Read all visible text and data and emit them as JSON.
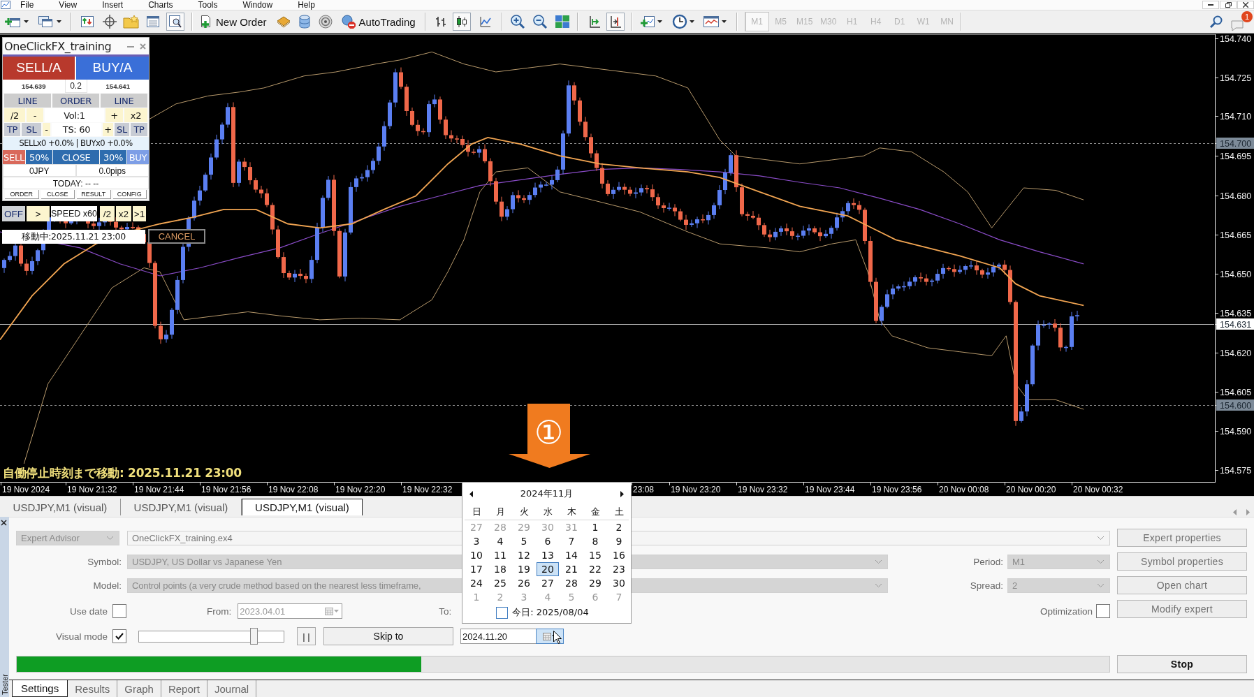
{
  "menu": [
    "File",
    "View",
    "Insert",
    "Charts",
    "Tools",
    "Window",
    "Help"
  ],
  "toolbar": {
    "tester_on": true,
    "new_order": "New Order",
    "autotrading": "AutoTrading",
    "chart_modes": [
      {
        "kind": "bar",
        "selected": false
      },
      {
        "kind": "candle",
        "selected": true
      },
      {
        "kind": "line",
        "selected": false
      }
    ],
    "auto_scroll_on": false,
    "chart_shift_on": true,
    "timeframes": [
      {
        "label": "M1",
        "selected": true,
        "disabled": true
      },
      {
        "label": "M5",
        "selected": false,
        "disabled": true
      },
      {
        "label": "M15",
        "selected": false,
        "disabled": true
      },
      {
        "label": "M30",
        "selected": false,
        "disabled": true
      },
      {
        "label": "H1",
        "selected": false,
        "disabled": true
      },
      {
        "label": "H4",
        "selected": false,
        "disabled": true
      },
      {
        "label": "D1",
        "selected": false,
        "disabled": true
      },
      {
        "label": "W1",
        "selected": false,
        "disabled": true
      },
      {
        "label": "MN",
        "selected": false,
        "disabled": true
      }
    ],
    "notifications": "1"
  },
  "chart": {
    "price_axis": [
      {
        "label": "154.740",
        "kind": "tick"
      },
      {
        "label": "154.725",
        "kind": "tick"
      },
      {
        "label": "154.710",
        "kind": "tick"
      },
      {
        "label": "154.700",
        "kind": "level"
      },
      {
        "label": "154.695",
        "kind": "tick"
      },
      {
        "label": "154.680",
        "kind": "tick"
      },
      {
        "label": "154.665",
        "kind": "tick"
      },
      {
        "label": "154.650",
        "kind": "tick"
      },
      {
        "label": "154.635",
        "kind": "tick"
      },
      {
        "label": "154.631",
        "kind": "bid"
      },
      {
        "label": "154.620",
        "kind": "tick"
      },
      {
        "label": "154.605",
        "kind": "tick"
      },
      {
        "label": "154.600",
        "kind": "level"
      },
      {
        "label": "154.590",
        "kind": "tick"
      },
      {
        "label": "154.575",
        "kind": "tick"
      }
    ],
    "time_axis": [
      "19 Nov 2024",
      "19 Nov 21:32",
      "19 Nov 21:44",
      "19 Nov 21:56",
      "19 Nov 22:08",
      "19 Nov 22:20",
      "19 Nov 22:32",
      "23:08",
      "19 Nov 23:20",
      "19 Nov 23:32",
      "19 Nov 23:44",
      "19 Nov 23:56",
      "20 Nov 00:08",
      "20 Nov 00:20",
      "20 Nov 00:32"
    ],
    "status": "自働停止時刻まで移動: 2025.11.21 23:00",
    "marker": "①"
  },
  "trade_panel": {
    "title": "OneClickFX_training",
    "sell_button": "SELL/A",
    "buy_button": "BUY/A",
    "lot": "0.2",
    "sell_price": "154.639",
    "buy_price": "154.641",
    "line_row": [
      "LINE",
      "ORDER",
      "LINE"
    ],
    "volume_row": [
      {
        "label": "/2",
        "kind": "step"
      },
      {
        "label": "-",
        "kind": "step"
      },
      {
        "label": "Vol:1",
        "kind": "value"
      },
      {
        "label": "+",
        "kind": "step"
      },
      {
        "label": "x2",
        "kind": "step"
      }
    ],
    "stop_row": [
      {
        "label": "TP",
        "kind": "tag"
      },
      {
        "label": "SL",
        "kind": "tag"
      },
      {
        "label": "-",
        "kind": "step"
      },
      {
        "label": "TS: 60",
        "kind": "value"
      },
      {
        "label": "+",
        "kind": "step"
      },
      {
        "label": "SL",
        "kind": "tag"
      },
      {
        "label": "TP",
        "kind": "tag"
      }
    ],
    "positions": "SELLx0 +0.0% | BUYx0 +0.0%",
    "close_row": [
      {
        "label": "SELL",
        "kind": "sell"
      },
      {
        "label": "50%",
        "kind": "close"
      },
      {
        "label": "CLOSE",
        "kind": "close"
      },
      {
        "label": "30%",
        "kind": "close"
      },
      {
        "label": "BUY",
        "kind": "buy"
      }
    ],
    "profit": "0JPY",
    "pips": "0.0pips",
    "today": "TODAY: -- --",
    "tabs": [
      "ORDER",
      "CLOSE",
      "RESULT",
      "CONFIG"
    ]
  },
  "speed_bar": [
    {
      "label": "OFF",
      "kind": "toggle"
    },
    {
      "label": ">",
      "kind": "step"
    },
    {
      "label": "SPEED x60",
      "kind": "value"
    },
    {
      "label": "/2",
      "kind": "step"
    },
    {
      "label": "x2",
      "kind": "step"
    },
    {
      "label": ">1",
      "kind": "step"
    }
  ],
  "move_status": "移動中:2025.11.21 23:00",
  "cancel_button": "CANCEL",
  "tester": {
    "tabs": [
      {
        "label": "USDJPY,M1 (visual)",
        "selected": false
      },
      {
        "label": "USDJPY,M1 (visual)",
        "selected": false
      },
      {
        "label": "USDJPY,M1 (visual)",
        "selected": true
      }
    ],
    "expert_type": {
      "value": "Expert Advisor",
      "disabled": true
    },
    "expert": {
      "value": "OneClickFX_training.ex4",
      "disabled": false
    },
    "symbol_label": "Symbol:",
    "symbol": {
      "value": "USDJPY, US Dollar vs Japanese Yen",
      "disabled": true
    },
    "period_label": "Period:",
    "period": {
      "value": "M1",
      "disabled": true
    },
    "model_label": "Model:",
    "model": {
      "value": "Control points (a very crude method based on the nearest less timeframe,",
      "disabled": true
    },
    "spread_label": "Spread:",
    "spread": {
      "value": "2",
      "disabled": true
    },
    "use_date_label": "Use date",
    "use_date": false,
    "from_label": "From:",
    "from": "2023.04.01",
    "to_label": "To:",
    "optimization_label": "Optimization",
    "optimization": false,
    "visual_mode_label": "Visual mode",
    "visual_mode": true,
    "speed": {
      "level": 0.79
    },
    "pause_button": "| |",
    "skip_button": "Skip to",
    "skip_date": {
      "value": "2024.11.20",
      "open": true
    },
    "buttons": [
      {
        "label": "Expert properties",
        "disabled": true
      },
      {
        "label": "Symbol properties",
        "disabled": true
      },
      {
        "label": "Open chart",
        "disabled": true
      },
      {
        "label": "Modify expert",
        "disabled": true
      }
    ],
    "progress": {
      "level": 0.37
    },
    "stop_button": "Stop",
    "bottom_tabs": [
      {
        "label": "Settings",
        "selected": true
      },
      {
        "label": "Results",
        "selected": false
      },
      {
        "label": "Graph",
        "selected": false
      },
      {
        "label": "Report",
        "selected": false
      },
      {
        "label": "Journal",
        "selected": false
      }
    ],
    "side_label": "Tester"
  },
  "calendar": {
    "month": "2024年11月",
    "weekdays": [
      "日",
      "月",
      "火",
      "水",
      "木",
      "金",
      "土"
    ],
    "days": [
      {
        "label": "27",
        "outside": true,
        "selected": false
      },
      {
        "label": "28",
        "outside": true,
        "selected": false
      },
      {
        "label": "29",
        "outside": true,
        "selected": false
      },
      {
        "label": "30",
        "outside": true,
        "selected": false
      },
      {
        "label": "31",
        "outside": true,
        "selected": false
      },
      {
        "label": "1",
        "outside": false,
        "selected": false
      },
      {
        "label": "2",
        "outside": false,
        "selected": false
      },
      {
        "label": "3",
        "outside": false,
        "selected": false
      },
      {
        "label": "4",
        "outside": false,
        "selected": false
      },
      {
        "label": "5",
        "outside": false,
        "selected": false
      },
      {
        "label": "6",
        "outside": false,
        "selected": false
      },
      {
        "label": "7",
        "outside": false,
        "selected": false
      },
      {
        "label": "8",
        "outside": false,
        "selected": false
      },
      {
        "label": "9",
        "outside": false,
        "selected": false
      },
      {
        "label": "10",
        "outside": false,
        "selected": false
      },
      {
        "label": "11",
        "outside": false,
        "selected": false
      },
      {
        "label": "12",
        "outside": false,
        "selected": false
      },
      {
        "label": "13",
        "outside": false,
        "selected": false
      },
      {
        "label": "14",
        "outside": false,
        "selected": false
      },
      {
        "label": "15",
        "outside": false,
        "selected": false
      },
      {
        "label": "16",
        "outside": false,
        "selected": false
      },
      {
        "label": "17",
        "outside": false,
        "selected": false
      },
      {
        "label": "18",
        "outside": false,
        "selected": false
      },
      {
        "label": "19",
        "outside": false,
        "selected": false
      },
      {
        "label": "20",
        "outside": false,
        "selected": true
      },
      {
        "label": "21",
        "outside": false,
        "selected": false
      },
      {
        "label": "22",
        "outside": false,
        "selected": false
      },
      {
        "label": "23",
        "outside": false,
        "selected": false
      },
      {
        "label": "24",
        "outside": false,
        "selected": false
      },
      {
        "label": "25",
        "outside": false,
        "selected": false
      },
      {
        "label": "26",
        "outside": false,
        "selected": false
      },
      {
        "label": "27",
        "outside": false,
        "selected": false
      },
      {
        "label": "28",
        "outside": false,
        "selected": false
      },
      {
        "label": "29",
        "outside": false,
        "selected": false
      },
      {
        "label": "30",
        "outside": false,
        "selected": false
      },
      {
        "label": "1",
        "outside": true,
        "selected": false
      },
      {
        "label": "2",
        "outside": true,
        "selected": false
      },
      {
        "label": "3",
        "outside": true,
        "selected": false
      },
      {
        "label": "4",
        "outside": true,
        "selected": false
      },
      {
        "label": "5",
        "outside": true,
        "selected": false
      },
      {
        "label": "6",
        "outside": true,
        "selected": false
      },
      {
        "label": "7",
        "outside": true,
        "selected": false
      }
    ],
    "today": "今日: 2025/08/04"
  }
}
